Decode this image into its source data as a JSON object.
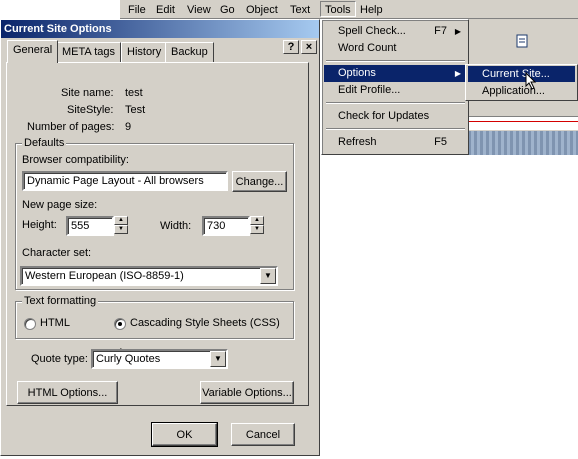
{
  "menubar": {
    "items": [
      "File",
      "Edit",
      "View",
      "Go",
      "Object",
      "Text",
      "Tools",
      "Help"
    ],
    "open_item": "Tools"
  },
  "tools_menu": {
    "items": [
      {
        "label": "Spell Check...",
        "shortcut": "F7",
        "submenu": true
      },
      {
        "label": "Word Count",
        "shortcut": "",
        "submenu": false
      },
      {
        "label": "Options",
        "shortcut": "",
        "submenu": true,
        "highlighted": true
      },
      {
        "label": "Edit Profile...",
        "shortcut": "",
        "submenu": false
      },
      {
        "label": "Check for Updates",
        "shortcut": "",
        "submenu": false
      },
      {
        "label": "Refresh",
        "shortcut": "F5",
        "submenu": false
      }
    ]
  },
  "options_submenu": {
    "items": [
      {
        "label": "Current Site...",
        "highlighted": true
      },
      {
        "label": "Application..."
      }
    ]
  },
  "dialog": {
    "title": "Current Site Options",
    "help_btn": "?",
    "close_btn": "×",
    "tabs": [
      "General",
      "META tags",
      "History",
      "Backup"
    ],
    "active_tab": "General",
    "site_name_label": "Site name:",
    "site_name": "test",
    "site_style_label": "SiteStyle:",
    "site_style": "Test",
    "num_pages_label": "Number of pages:",
    "num_pages": "9",
    "defaults": {
      "legend": "Defaults",
      "browser_compat_label": "Browser compatibility:",
      "browser_compat_value": "Dynamic Page Layout - All browsers",
      "change_btn": "Change...",
      "page_size_label": "New page size:",
      "height_label": "Height:",
      "height_value": "555",
      "width_label": "Width:",
      "width_value": "730",
      "charset_label": "Character set:",
      "charset_value": "Western European (ISO-8859-1)"
    },
    "text_formatting": {
      "legend": "Text formatting",
      "html_label": "HTML",
      "css_label": "Cascading Style Sheets (CSS)",
      "selected": "css"
    },
    "quote_type_label": "Quote type:",
    "quote_type_value": "Curly Quotes",
    "html_options_btn": "HTML Options...",
    "variable_options_btn": "Variable Options...",
    "ok_btn": "OK",
    "cancel_btn": "Cancel"
  },
  "toolbar": {
    "new_page_icon": "new-page-icon"
  }
}
